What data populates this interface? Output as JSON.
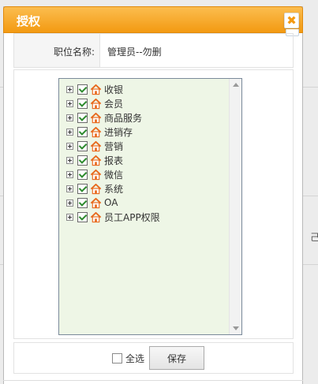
{
  "dialog": {
    "title": "授权",
    "close_glyph": "✖",
    "colors": {
      "titlebar": "#f5a623",
      "tree_bg": "#eef6e6",
      "check": "#2e8b2e"
    }
  },
  "position_field": {
    "label": "职位名称:",
    "value": "管理员--勿删"
  },
  "tree": {
    "items": [
      {
        "label": "收银",
        "checked": true,
        "icon": "home-icon"
      },
      {
        "label": "会员",
        "checked": true,
        "icon": "home-icon"
      },
      {
        "label": "商品服务",
        "checked": true,
        "icon": "home-icon"
      },
      {
        "label": "进销存",
        "checked": true,
        "icon": "home-icon"
      },
      {
        "label": "营销",
        "checked": true,
        "icon": "home-icon"
      },
      {
        "label": "报表",
        "checked": true,
        "icon": "home-icon"
      },
      {
        "label": "微信",
        "checked": true,
        "icon": "home-icon"
      },
      {
        "label": "系统",
        "checked": true,
        "icon": "home-icon"
      },
      {
        "label": "OA",
        "checked": true,
        "icon": "home-icon"
      },
      {
        "label": "员工APP权限",
        "checked": true,
        "icon": "home-icon"
      }
    ]
  },
  "footer": {
    "select_all_label": "全选",
    "select_all_checked": false,
    "save_label": "保存"
  },
  "background": {
    "edge_text": "己"
  }
}
